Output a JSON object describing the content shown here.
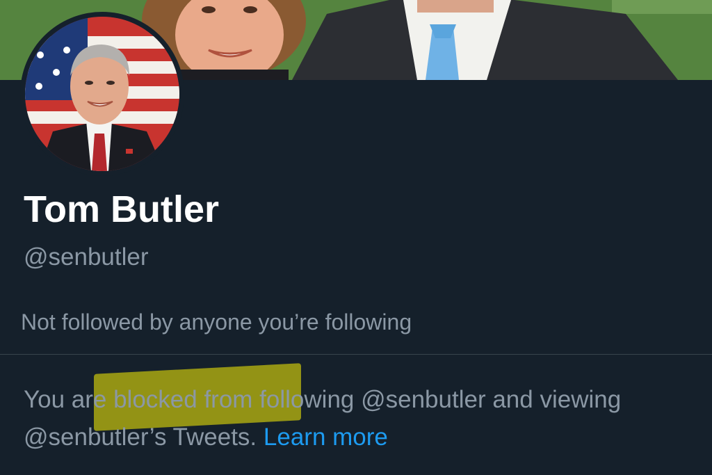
{
  "profile": {
    "display_name": "Tom Butler",
    "handle": "@senbutler",
    "followed_by": "Not followed by anyone you’re following"
  },
  "notice": {
    "text": "You are blocked from following @senbutler and viewing @senbutler’s Tweets.",
    "link_label": "Learn more"
  },
  "colors": {
    "background": "#15202b",
    "text_primary": "#ffffff",
    "text_secondary": "#8b98a5",
    "link": "#1d9bf0",
    "divider": "#38444d",
    "highlight": "#a9a812"
  }
}
